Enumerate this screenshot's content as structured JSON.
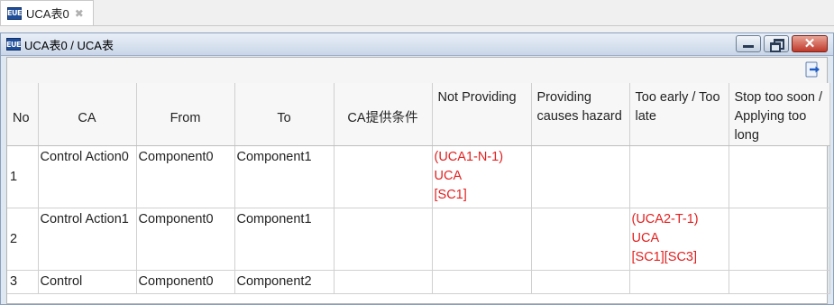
{
  "tab": {
    "label": "UCA表0",
    "icon": "ue-table-icon"
  },
  "window": {
    "title": "UCA表0 / UCA表",
    "buttons": {
      "minimize": "minimize-icon",
      "restore": "restore-icon",
      "close": "close-icon"
    }
  },
  "icon_text": "EUE",
  "table": {
    "headers": {
      "no": "No",
      "ca": "CA",
      "from": "From",
      "to": "To",
      "condition": "CA提供条件",
      "not_providing": "Not Providing",
      "providing": "Providing causes hazard",
      "timing": "Too early / Too late",
      "duration": "Stop too soon / Applying too long"
    },
    "rows": [
      {
        "no": "1",
        "ca": "Control Action0",
        "from": "Component0",
        "to": "Component1",
        "condition": "",
        "not_providing": "(UCA1-N-1) UCA\n[SC1]",
        "providing": "",
        "timing": "",
        "duration": ""
      },
      {
        "no": "2",
        "ca": "Control Action1",
        "from": "Component0",
        "to": "Component1",
        "condition": "",
        "not_providing": "",
        "providing": "",
        "timing": "(UCA2-T-1) UCA\n[SC1][SC3]",
        "duration": ""
      },
      {
        "no": "3",
        "ca": "Control",
        "from": "Component0",
        "to": "Component2",
        "condition": "",
        "not_providing": "",
        "providing": "",
        "timing": "",
        "duration": ""
      }
    ]
  },
  "colors": {
    "uca_text": "#e32020",
    "title_gradient": "#c9d6e8"
  }
}
